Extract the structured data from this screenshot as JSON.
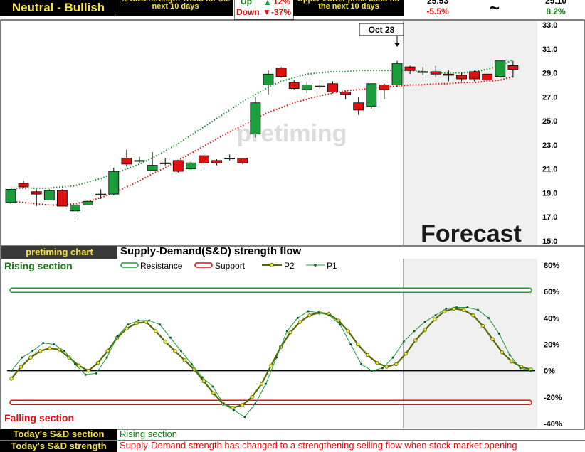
{
  "header": {
    "trend_title": "Neutral - Bullish",
    "sd_trend_caption": "% S&D strength Trend for the next 10 days",
    "up_label": "Up",
    "up_value": "12%",
    "down_label": "Down",
    "down_value": "-37%",
    "band_caption": "Upper-Lower price band for the next 10 days",
    "lower_price": "25.53",
    "lower_pct": "-5.5%",
    "tilde": "~",
    "upper_price": "29.10",
    "upper_pct": "8.2%"
  },
  "price_panel": {
    "watermark": "pretiming",
    "forecast_label": "Forecast",
    "date_callout": "Oct 28"
  },
  "flow_panel": {
    "chart_label": "pretiming chart",
    "title": "Supply-Demand(S&D)  strength flow",
    "rising_label": "Rising section",
    "falling_label": "Falling section"
  },
  "footer": {
    "section_label": "Today's S&D section",
    "section_value": "Rising section",
    "strength_label": "Today's S&D strength",
    "strength_value": "Supply-Demand strength has changed to a strengthening selling flow when stock market opening"
  },
  "chart_data": [
    {
      "type": "candlestick",
      "ylim": [
        15,
        33
      ],
      "yticks": [
        "15.0",
        "17.0",
        "19.0",
        "21.0",
        "23.0",
        "25.0",
        "27.0",
        "29.0",
        "31.0",
        "33.0"
      ],
      "forecast_start_index": 31,
      "colors": {
        "up": "#1a9e3c",
        "down": "#e01010"
      },
      "candles": [
        {
          "o": 18.2,
          "h": 19.3,
          "l": 18.1,
          "c": 19.3
        },
        {
          "o": 19.8,
          "h": 20.0,
          "l": 19.4,
          "c": 19.5
        },
        {
          "o": 19.1,
          "h": 19.3,
          "l": 17.9,
          "c": 18.9
        },
        {
          "o": 18.4,
          "h": 19.3,
          "l": 18.4,
          "c": 19.2
        },
        {
          "o": 19.2,
          "h": 19.3,
          "l": 17.9,
          "c": 17.9
        },
        {
          "o": 17.5,
          "h": 18.2,
          "l": 16.8,
          "c": 18.0
        },
        {
          "o": 18.0,
          "h": 18.3,
          "l": 18.0,
          "c": 18.3
        },
        {
          "o": 18.9,
          "h": 19.3,
          "l": 18.5,
          "c": 18.9
        },
        {
          "o": 18.9,
          "h": 21.1,
          "l": 18.8,
          "c": 20.8
        },
        {
          "o": 21.9,
          "h": 22.6,
          "l": 21.2,
          "c": 21.4
        },
        {
          "o": 21.7,
          "h": 22.0,
          "l": 21.5,
          "c": 21.7
        },
        {
          "o": 20.9,
          "h": 22.4,
          "l": 20.9,
          "c": 21.3
        },
        {
          "o": 21.5,
          "h": 21.9,
          "l": 21.3,
          "c": 21.5
        },
        {
          "o": 21.7,
          "h": 21.7,
          "l": 20.7,
          "c": 20.8
        },
        {
          "o": 21.0,
          "h": 21.6,
          "l": 20.9,
          "c": 21.5
        },
        {
          "o": 22.1,
          "h": 22.3,
          "l": 21.3,
          "c": 21.5
        },
        {
          "o": 21.7,
          "h": 21.8,
          "l": 21.3,
          "c": 21.5
        },
        {
          "o": 21.9,
          "h": 22.2,
          "l": 21.7,
          "c": 21.9
        },
        {
          "o": 21.9,
          "h": 21.9,
          "l": 21.4,
          "c": 21.5
        },
        {
          "o": 23.9,
          "h": 27.0,
          "l": 23.6,
          "c": 26.5
        },
        {
          "o": 28.0,
          "h": 29.2,
          "l": 27.2,
          "c": 28.9
        },
        {
          "o": 29.4,
          "h": 29.5,
          "l": 28.6,
          "c": 28.7
        },
        {
          "o": 28.2,
          "h": 28.4,
          "l": 27.6,
          "c": 27.7
        },
        {
          "o": 27.6,
          "h": 28.3,
          "l": 27.3,
          "c": 28.0
        },
        {
          "o": 27.9,
          "h": 28.2,
          "l": 27.6,
          "c": 27.9
        },
        {
          "o": 28.1,
          "h": 28.3,
          "l": 27.3,
          "c": 27.4
        },
        {
          "o": 27.4,
          "h": 27.5,
          "l": 26.8,
          "c": 27.2
        },
        {
          "o": 26.5,
          "h": 27.0,
          "l": 25.5,
          "c": 25.9
        },
        {
          "o": 26.2,
          "h": 28.1,
          "l": 26.0,
          "c": 28.1
        },
        {
          "o": 28.0,
          "h": 28.1,
          "l": 26.8,
          "c": 27.6
        },
        {
          "o": 28.0,
          "h": 30.0,
          "l": 27.8,
          "c": 29.8
        },
        {
          "o": 29.5,
          "h": 29.6,
          "l": 28.9,
          "c": 29.2
        },
        {
          "o": 29.1,
          "h": 29.5,
          "l": 28.8,
          "c": 29.1
        },
        {
          "o": 29.1,
          "h": 29.6,
          "l": 28.6,
          "c": 28.9
        },
        {
          "o": 28.9,
          "h": 29.2,
          "l": 28.3,
          "c": 28.8
        },
        {
          "o": 28.8,
          "h": 29.0,
          "l": 28.3,
          "c": 28.5
        },
        {
          "o": 29.1,
          "h": 29.2,
          "l": 28.3,
          "c": 28.5
        },
        {
          "o": 28.9,
          "h": 28.9,
          "l": 28.3,
          "c": 28.4
        },
        {
          "o": 28.7,
          "h": 30.0,
          "l": 28.6,
          "c": 30.0
        },
        {
          "o": 29.6,
          "h": 30.0,
          "l": 28.6,
          "c": 29.3
        }
      ],
      "upper_band": [
        19.4,
        19.4,
        19.4,
        19.4,
        19.5,
        19.6,
        19.9,
        20.2,
        20.6,
        21.0,
        21.4,
        21.9,
        22.5,
        23.1,
        23.8,
        24.5,
        25.2,
        25.9,
        26.6,
        27.2,
        27.8,
        28.3,
        28.6,
        28.9,
        29.0,
        29.1,
        29.1,
        29.2,
        29.2,
        29.2,
        29.2,
        29.2,
        29.1,
        29.0,
        29.0,
        29.0,
        29.1,
        29.3,
        29.6,
        30.1
      ],
      "lower_band": [
        18.3,
        18.2,
        18.1,
        18.0,
        18.0,
        18.1,
        18.3,
        18.6,
        19.0,
        19.5,
        20.0,
        20.6,
        21.1,
        21.7,
        22.3,
        22.9,
        23.5,
        24.1,
        24.6,
        25.2,
        25.7,
        26.1,
        26.5,
        26.8,
        27.1,
        27.3,
        27.5,
        27.6,
        27.7,
        27.8,
        27.9,
        28.0,
        28.0,
        28.1,
        28.1,
        28.2,
        28.2,
        28.3,
        28.4,
        28.7
      ]
    },
    {
      "type": "line",
      "title": "Supply-Demand(S&D)  strength flow",
      "ylim": [
        -40,
        80
      ],
      "yticks": [
        "-40%",
        "-20%",
        "0%",
        "20%",
        "40%",
        "60%",
        "80%"
      ],
      "resistance": 61,
      "support": -24,
      "legend": [
        "Resistance",
        "Support",
        "P2",
        "P1"
      ],
      "series": [
        {
          "name": "P2",
          "color": "#556b00",
          "values": [
            -6,
            3,
            10,
            15,
            17,
            16,
            10,
            4,
            0,
            6,
            15,
            25,
            32,
            36,
            37,
            30,
            22,
            15,
            8,
            1,
            -8,
            -17,
            -25,
            -28,
            -26,
            -20,
            -10,
            4,
            18,
            29,
            37,
            42,
            44,
            43,
            38,
            30,
            20,
            12,
            6,
            3,
            5,
            13,
            23,
            31,
            39,
            45,
            47,
            46,
            42,
            34,
            24,
            14,
            7,
            3,
            1
          ]
        },
        {
          "name": "P1",
          "color": "#1a9e3c",
          "values": [
            0,
            10,
            15,
            21,
            20,
            15,
            5,
            -3,
            -2,
            10,
            26,
            35,
            38,
            38,
            35,
            25,
            15,
            5,
            -5,
            -12,
            -25,
            -30,
            -35,
            -25,
            -10,
            10,
            30,
            40,
            45,
            44,
            42,
            35,
            20,
            5,
            0,
            2,
            10,
            22,
            30,
            37,
            42,
            47,
            48,
            48,
            46,
            40,
            28,
            12,
            2,
            0
          ]
        }
      ]
    }
  ]
}
